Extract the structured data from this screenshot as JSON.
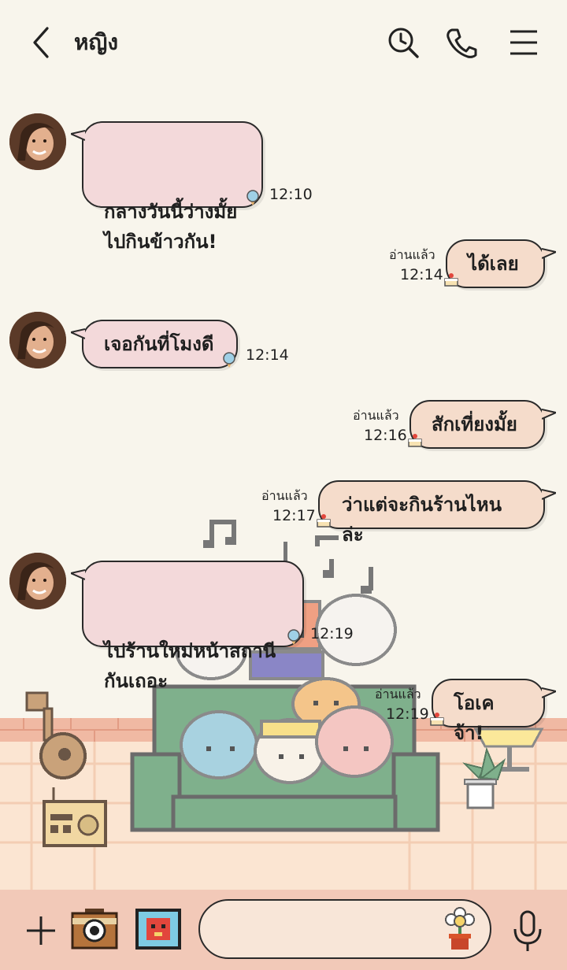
{
  "header": {
    "title": "หญิง",
    "icons": [
      "back-icon",
      "history-clock-search-icon",
      "phone-icon",
      "menu-icon"
    ]
  },
  "messages": [
    {
      "side": "in",
      "text": "กลางวันนี้ว่างมั้ย\nไปกินข้าวกัน!",
      "time": "12:10"
    },
    {
      "side": "out",
      "text": "ได้เลย",
      "time": "12:14",
      "read": "อ่านแล้ว"
    },
    {
      "side": "in",
      "text": "เจอกันที่โมงดี",
      "time": "12:14"
    },
    {
      "side": "out",
      "text": "สักเที่ยงมั้ย",
      "time": "12:16",
      "read": "อ่านแล้ว"
    },
    {
      "side": "out",
      "text": "ว่าแต่จะกินร้านไหนล่ะ",
      "time": "12:17",
      "read": "อ่านแล้ว"
    },
    {
      "side": "in",
      "text": "ไปร้านใหม่หน้าสถานี\nกันเถอะ",
      "time": "12:19"
    },
    {
      "side": "out",
      "text": "โอเคจ้า!",
      "time": "12:19",
      "read": "อ่านแล้ว"
    }
  ],
  "bottom": {
    "input_value": "",
    "icons": [
      "plus-icon",
      "camera-icon",
      "image-icon",
      "sticker-flower-icon",
      "mic-icon"
    ]
  },
  "colors": {
    "background": "#f8f5ec",
    "incoming_bubble": "#f3d9da",
    "outgoing_bubble": "#f5dccb",
    "bottom_bar": "#f2c9b8"
  }
}
